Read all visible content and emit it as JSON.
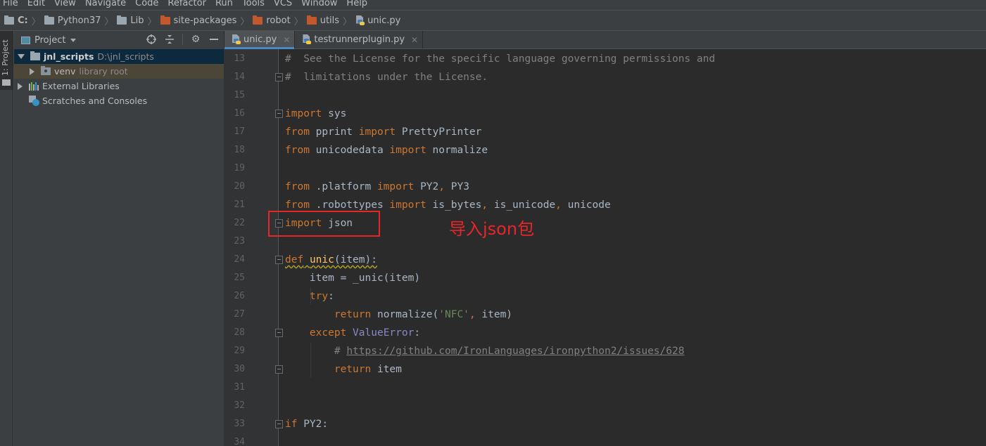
{
  "menu": [
    "File",
    "Edit",
    "View",
    "Navigate",
    "Code",
    "Refactor",
    "Run",
    "Tools",
    "VCS",
    "Window",
    "Help"
  ],
  "breadcrumbs": [
    {
      "label": "C:",
      "icon": "folder-icon",
      "color": "grey",
      "bold": true
    },
    {
      "label": "Python37",
      "icon": "folder-icon",
      "color": "grey"
    },
    {
      "label": "Lib",
      "icon": "folder-icon",
      "color": "grey"
    },
    {
      "label": "site-packages",
      "icon": "folder-icon",
      "color": "orange"
    },
    {
      "label": "robot",
      "icon": "folder-icon",
      "color": "orange"
    },
    {
      "label": "utils",
      "icon": "folder-icon",
      "color": "orange"
    },
    {
      "label": "unic.py",
      "icon": "python-file-icon"
    }
  ],
  "stripe": {
    "project_tab": "1: Project"
  },
  "project_panel": {
    "title": "Project",
    "tools": [
      "locate-icon",
      "collapse-all-icon",
      "gear-icon",
      "minimize-icon"
    ],
    "tree": [
      {
        "name": "jnl_scripts",
        "path": "D:\\jnl_scripts",
        "expanded": true,
        "selected": true
      },
      {
        "name": "venv",
        "note": "library root",
        "expanded": false
      },
      {
        "name": "External Libraries",
        "expanded": false
      },
      {
        "name": "Scratches and Consoles"
      }
    ]
  },
  "editor": {
    "tabs": [
      {
        "label": "unic.py",
        "active": true
      },
      {
        "label": "testrunnerplugin.py",
        "active": false
      }
    ],
    "lines": [
      13,
      14,
      15,
      16,
      17,
      18,
      19,
      20,
      21,
      22,
      23,
      24,
      25,
      26,
      27,
      28,
      29,
      30,
      31,
      32,
      33,
      34
    ],
    "code": {
      "l13": "#  See the License for the specific language governing permissions and",
      "l14": "#  limitations under the License.",
      "l16_kw": "import",
      "l16_rest": " sys",
      "l17_a": "from",
      "l17_b": " pprint ",
      "l17_c": "import",
      "l17_d": " PrettyPrinter",
      "l18_a": "from",
      "l18_b": " unicodedata ",
      "l18_c": "import",
      "l18_d": " normalize",
      "l20_a": "from",
      "l20_b": " .platform ",
      "l20_c": "import",
      "l20_d": " PY2",
      "l20_e": ",",
      "l20_f": " PY3",
      "l21_a": "from",
      "l21_b": " .robottypes ",
      "l21_c": "import",
      "l21_d": " is_bytes",
      "l21_e": ",",
      "l21_f": " is_unicode",
      "l21_g": ",",
      "l21_h": " unicode",
      "l22_kw": "import",
      "l22_rest": " json",
      "l24_kw": "def",
      "l24_sp": " ",
      "l24_fn": "unic",
      "l24_rest": "(item):",
      "l25": "    item = _unic(item)",
      "l26_ind": "    ",
      "l26_kw": "try",
      "l26_rest": ":",
      "l27_ind": "        ",
      "l27_kw": "return",
      "l27_b": " normalize(",
      "l27_str": "'NFC'",
      "l27_c": ",",
      "l27_d": " item)",
      "l28_ind": "    ",
      "l28_kw": "except",
      "l28_sp": " ",
      "l28_bi": "ValueError",
      "l28_rest": ":",
      "l29_ind": "        ",
      "l29_hash": "# ",
      "l29_link": "https://github.com/IronLanguages/ironpython2/issues/628",
      "l30_ind": "        ",
      "l30_kw": "return",
      "l30_rest": " item",
      "l33_kw": "if",
      "l33_rest": " PY2:"
    }
  },
  "annotation": {
    "text": "导入json包",
    "color": "#e8262a"
  }
}
